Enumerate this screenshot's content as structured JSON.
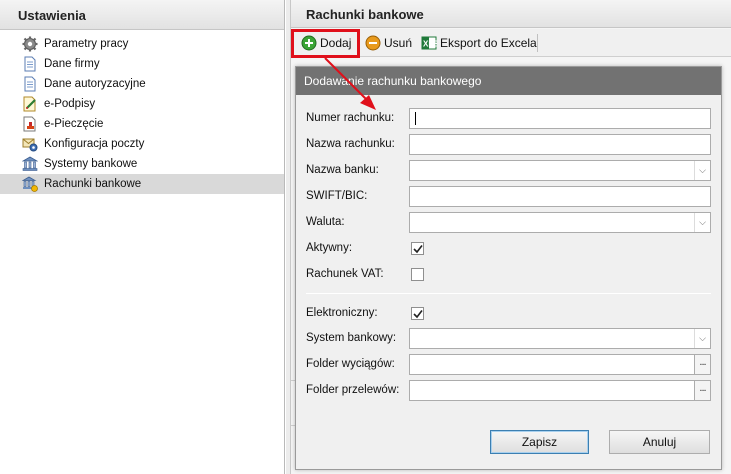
{
  "left_panel": {
    "title": "Ustawienia",
    "items": [
      {
        "label": "Parametry pracy",
        "icon": "gear-icon",
        "selected": false
      },
      {
        "label": "Dane firmy",
        "icon": "document-icon",
        "selected": false
      },
      {
        "label": "Dane autoryzacyjne",
        "icon": "document-icon",
        "selected": false
      },
      {
        "label": "e-Podpisy",
        "icon": "pen-document-icon",
        "selected": false
      },
      {
        "label": "e-Pieczęcie",
        "icon": "stamp-document-icon",
        "selected": false
      },
      {
        "label": "Konfiguracja poczty",
        "icon": "mail-gear-icon",
        "selected": false
      },
      {
        "label": "Systemy bankowe",
        "icon": "bank-icon",
        "selected": false
      },
      {
        "label": "Rachunki bankowe",
        "icon": "bank-account-icon",
        "selected": true
      }
    ]
  },
  "right_panel": {
    "title": "Rachunki bankowe",
    "toolbar": {
      "add_label": "Dodaj",
      "remove_label": "Usuń",
      "export_label": "Eksport do Excela"
    }
  },
  "dialog": {
    "title": "Dodawanie rachunku bankowego",
    "fields": {
      "account_number": {
        "label": "Numer rachunku:",
        "value": ""
      },
      "account_name": {
        "label": "Nazwa rachunku:",
        "value": ""
      },
      "bank_name": {
        "label": "Nazwa banku:",
        "value": ""
      },
      "swift": {
        "label": "SWIFT/BIC:",
        "value": ""
      },
      "currency": {
        "label": "Waluta:",
        "value": ""
      },
      "active": {
        "label": "Aktywny:",
        "checked": true
      },
      "vat_account": {
        "label": "Rachunek VAT:",
        "checked": false
      },
      "electronic": {
        "label": "Elektroniczny:",
        "checked": true
      },
      "bank_system": {
        "label": "System bankowy:",
        "value": ""
      },
      "statements_folder": {
        "label": "Folder wyciągów:",
        "value": ""
      },
      "transfers_folder": {
        "label": "Folder przelewów:",
        "value": ""
      }
    },
    "buttons": {
      "save": "Zapisz",
      "cancel": "Anuluj"
    }
  },
  "colors": {
    "highlight": "#e0101b",
    "dialog_title_bg": "#727272",
    "selection_bg": "#d9d9d9",
    "add_icon": "#3aa435",
    "remove_icon": "#e89a1c",
    "excel_icon": "#1f7a3a"
  }
}
